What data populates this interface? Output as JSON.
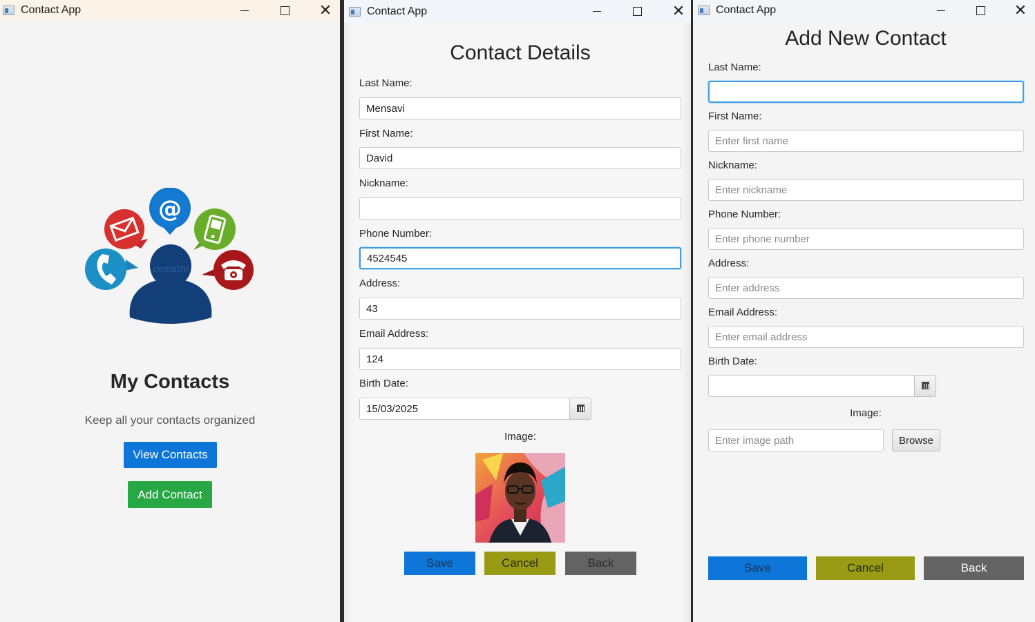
{
  "windows": {
    "home": {
      "title": "Contact App",
      "heading": "My Contacts",
      "subtitle": "Keep all your contacts organized",
      "view_button": "View Contacts",
      "add_button": "Add Contact",
      "logo_watermark": "comsthi"
    },
    "details": {
      "title": "Contact Details",
      "window_title": "Contact App",
      "fields": {
        "last_name": {
          "label": "Last Name:",
          "value": "Mensavi"
        },
        "first_name": {
          "label": "First Name:",
          "value": "David"
        },
        "nickname": {
          "label": "Nickname:",
          "value": ""
        },
        "phone": {
          "label": "Phone Number:",
          "value": "4524545"
        },
        "address": {
          "label": "Address:",
          "value": "43"
        },
        "email": {
          "label": "Email Address:",
          "value": "124"
        },
        "birth_date": {
          "label": "Birth Date:",
          "value": "15/03/2025"
        }
      },
      "image_label": "Image:",
      "buttons": {
        "save": "Save",
        "cancel": "Cancel",
        "back": "Back"
      }
    },
    "add": {
      "title": "Add New Contact",
      "window_title": "Contact App",
      "fields": {
        "last_name": {
          "label": "Last Name:",
          "placeholder": ""
        },
        "first_name": {
          "label": "First Name:",
          "placeholder": "Enter first name"
        },
        "nickname": {
          "label": "Nickname:",
          "placeholder": "Enter nickname"
        },
        "phone": {
          "label": "Phone Number:",
          "placeholder": "Enter phone number"
        },
        "address": {
          "label": "Address:",
          "placeholder": "Enter address"
        },
        "email": {
          "label": "Email Address:",
          "placeholder": "Enter email address"
        },
        "birth_date": {
          "label": "Birth Date:",
          "placeholder": ""
        }
      },
      "image_label": "Image:",
      "image_path_placeholder": "Enter image path",
      "browse_button": "Browse",
      "buttons": {
        "save": "Save",
        "cancel": "Cancel",
        "back": "Back"
      }
    }
  },
  "colors": {
    "primary_blue": "#0d76d8",
    "success_green": "#28a745",
    "cancel_olive": "#999b15",
    "back_gray": "#636363",
    "focus_blue": "#3d9ee0"
  }
}
